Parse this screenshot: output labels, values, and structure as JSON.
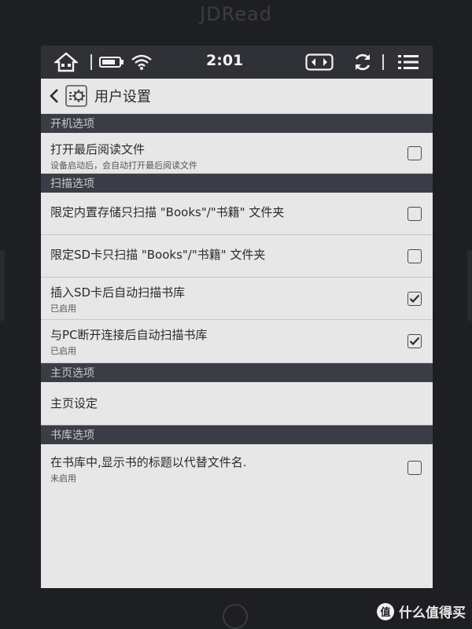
{
  "device": {
    "brand": "JDRead"
  },
  "statusbar": {
    "time": "2:01",
    "icons": [
      "home-icon",
      "battery-icon",
      "wifi-icon",
      "page-turn-icon",
      "refresh-icon",
      "menu-icon"
    ]
  },
  "titlebar": {
    "title": "用户设置"
  },
  "sections": {
    "boot": {
      "header": "开机选项"
    },
    "scan": {
      "header": "扫描选项"
    },
    "home": {
      "header": "主页选项"
    },
    "library": {
      "header": "书库选项"
    }
  },
  "settings": {
    "open_last": {
      "label": "打开最后阅读文件",
      "sub": "设备启动后，会自动打开最后阅读文件",
      "checked": false
    },
    "internal_books": {
      "label": "限定内置存储只扫描 \"Books\"/\"书籍\" 文件夹",
      "checked": false
    },
    "sd_books": {
      "label": "限定SD卡只扫描 \"Books\"/\"书籍\" 文件夹",
      "checked": false
    },
    "sd_autoscan": {
      "label": "插入SD卡后自动扫描书库",
      "sub": "已启用",
      "checked": true
    },
    "pc_autoscan": {
      "label": "与PC断开连接后自动扫描书库",
      "sub": "已启用",
      "checked": true
    },
    "home_setting": {
      "label": "主页设定"
    },
    "show_title": {
      "label": "在书库中,显示书的标题以代替文件名.",
      "sub": "未启用",
      "checked": false
    }
  },
  "watermark": {
    "badge": "值",
    "text": "什么值得买"
  },
  "colors": {
    "bezel": "#1e1f22",
    "screen": "#e7e7e7",
    "section": "#3a3d45",
    "statusbar": "#2f3136"
  }
}
